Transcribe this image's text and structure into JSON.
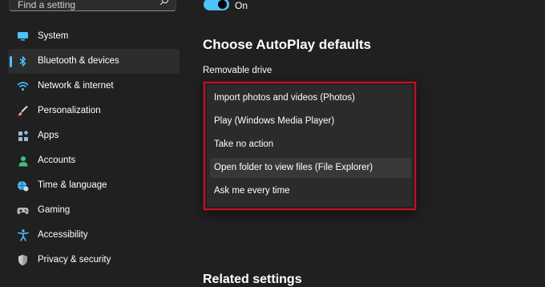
{
  "search": {
    "placeholder": "Find a setting"
  },
  "sidebar": {
    "items": [
      {
        "label": "System",
        "icon": "monitor-icon",
        "color": "#4cc2ff"
      },
      {
        "label": "Bluetooth & devices",
        "icon": "bluetooth-icon",
        "color": "#4cc2ff",
        "selected": true
      },
      {
        "label": "Network & internet",
        "icon": "wifi-icon",
        "color": "#4cc2ff"
      },
      {
        "label": "Personalization",
        "icon": "brush-icon",
        "color": "#e8a37a"
      },
      {
        "label": "Apps",
        "icon": "apps-icon",
        "color": "#9fb7cf"
      },
      {
        "label": "Accounts",
        "icon": "person-icon",
        "color": "#3fbf7f"
      },
      {
        "label": "Time & language",
        "icon": "globe-clock-icon",
        "color": "#4cc2ff"
      },
      {
        "label": "Gaming",
        "icon": "gamepad-icon",
        "color": "#b9b9b9"
      },
      {
        "label": "Accessibility",
        "icon": "accessibility-icon",
        "color": "#4cc2ff"
      },
      {
        "label": "Privacy & security",
        "icon": "shield-icon",
        "color": "#9a9a9a"
      }
    ]
  },
  "autoplay_toggle": {
    "label": "On",
    "state": "on"
  },
  "main": {
    "heading": "Choose AutoPlay defaults",
    "removable_drive_label": "Removable drive",
    "dropdown_options": [
      "Import photos and videos (Photos)",
      "Play (Windows Media Player)",
      "Take no action",
      "Open folder to view files (File Explorer)",
      "Ask me every time"
    ],
    "highlighted_option": "Open folder to view files (File Explorer)",
    "related_heading": "Related settings"
  },
  "colors": {
    "accent": "#4cc2ff",
    "highlight_outline": "#c1121f",
    "background": "#202020"
  }
}
